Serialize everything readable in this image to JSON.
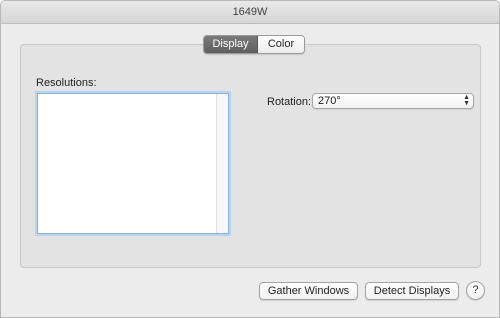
{
  "window": {
    "title": "1649W"
  },
  "tabs": [
    {
      "label": "Display",
      "active": true
    },
    {
      "label": "Color",
      "active": false
    }
  ],
  "resolutions": {
    "label": "Resolutions:",
    "items": []
  },
  "rotation": {
    "label": "Rotation:",
    "value": "270°"
  },
  "buttons": {
    "gather": "Gather Windows",
    "detect": "Detect Displays",
    "help": "?"
  }
}
